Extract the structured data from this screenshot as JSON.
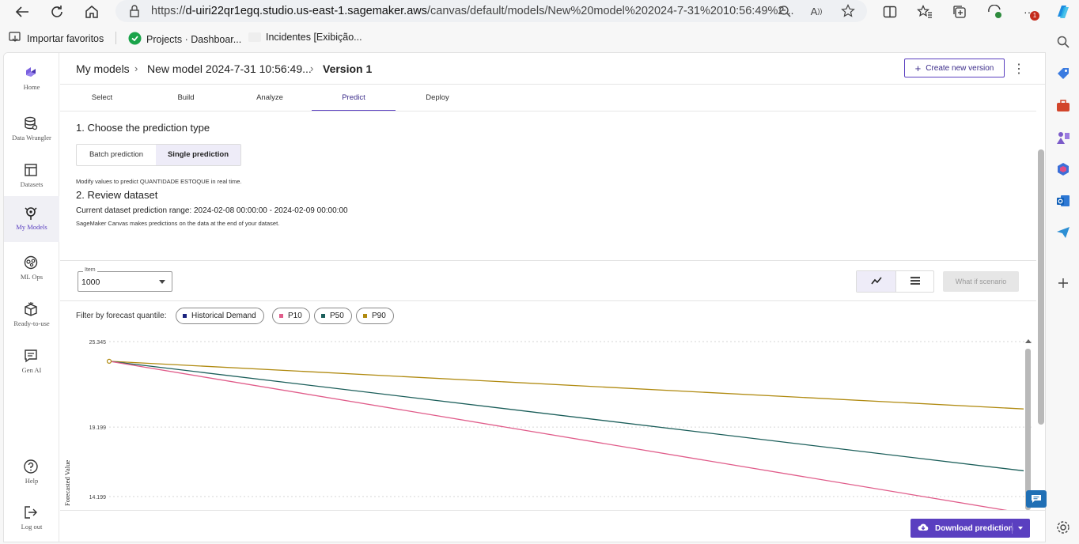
{
  "browser": {
    "url_prefix": "https://",
    "url_host": "d-uiri22qr1egq.studio.us-east-1.sagemaker.aws",
    "url_path": "/canvas/default/models/New%20model%202024-7-31%2010:56:49%2...",
    "notification_count": "1"
  },
  "bookmarks": {
    "import": "Importar favoritos",
    "projects": "Projects · Dashboar...",
    "incidents": "Incidentes [Exibição..."
  },
  "leftnav": {
    "items": [
      {
        "label": "Home",
        "icon": "home-logo-icon"
      },
      {
        "label": "Data Wrangler",
        "icon": "database-icon"
      },
      {
        "label": "Datasets",
        "icon": "table-icon"
      },
      {
        "label": "My Models",
        "icon": "brain-icon"
      },
      {
        "label": "ML Ops",
        "icon": "mlops-icon"
      },
      {
        "label": "Ready-to-use",
        "icon": "box-icon"
      },
      {
        "label": "Gen AI",
        "icon": "chat-icon"
      },
      {
        "label": "Help",
        "icon": "help-icon"
      },
      {
        "label": "Log out",
        "icon": "logout-icon"
      }
    ]
  },
  "header": {
    "crumb1": "My models",
    "crumb2": "New model 2024-7-31 10:56:49...",
    "crumb3": "Version 1",
    "create_label": "Create new version"
  },
  "tabs": [
    "Select",
    "Build",
    "Analyze",
    "Predict",
    "Deploy"
  ],
  "active_tab": "Predict",
  "section1": {
    "title": "1. Choose the prediction type",
    "option_batch": "Batch prediction",
    "option_single": "Single prediction",
    "hint": "Modify values to predict QUANTIDADE ESTOQUE in real time."
  },
  "section2": {
    "title": "2. Review dataset",
    "range": "Current dataset prediction range: 2024-02-08 00:00:00 - 2024-02-09 00:00:00",
    "note": "SageMaker Canvas makes predictions on the data at the end of your dataset."
  },
  "controls": {
    "item_legend": "Item",
    "item_value": "1000",
    "what_if": "What if scenario",
    "filter_label": "Filter by forecast quantile:"
  },
  "quantiles": [
    {
      "label": "Historical Demand",
      "color": "#1a237e"
    },
    {
      "label": "P10",
      "color": "#e05c8a"
    },
    {
      "label": "P50",
      "color": "#1b5e5a"
    },
    {
      "label": "P90",
      "color": "#b08a10"
    }
  ],
  "chart_data": {
    "type": "line",
    "ylabel": "Forecasted Value",
    "y_ticks": [
      "25.345",
      "19.199",
      "14.199"
    ],
    "y_tick_values": [
      25.345,
      19.199,
      14.199
    ],
    "x": [
      0,
      1
    ],
    "series": [
      {
        "name": "P10",
        "color": "#e05c8a",
        "values": [
          23.93,
          13.0
        ]
      },
      {
        "name": "P50",
        "color": "#1b5e5a",
        "values": [
          23.93,
          16.05
        ]
      },
      {
        "name": "P90",
        "color": "#b08a10",
        "values": [
          23.93,
          20.5
        ]
      }
    ]
  },
  "footer": {
    "download_label": "Download prediction"
  }
}
